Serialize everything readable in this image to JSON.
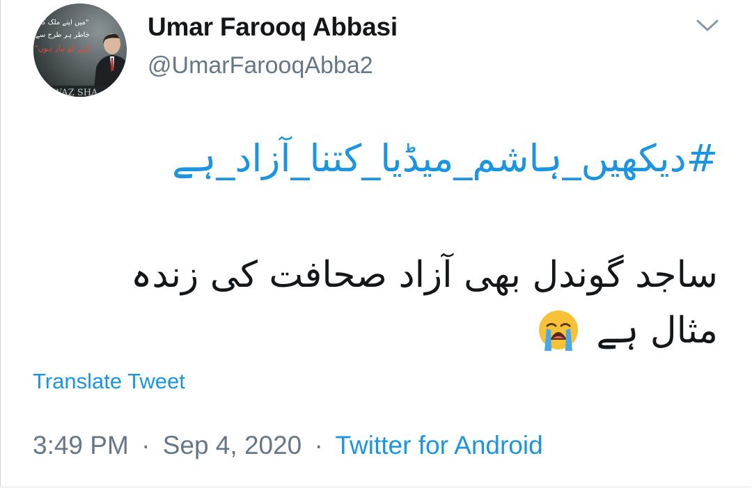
{
  "author": {
    "display_name": "Umar Farooq Abbasi",
    "handle": "@UmarFarooqAbba2",
    "avatar": {
      "icon": "profile-photo",
      "overlay_text_lines": [
        "\"میں اپنے ملک کی",
        "خاطر ہر طرح سے",
        "لڑنے کو تیار ہوں\""
      ],
      "footer_text": "WAZ SHA"
    }
  },
  "menu": {
    "icon": "chevron-down-icon"
  },
  "tweet": {
    "hashtag": "#دیکھیں_ہاشم_میڈیا_کتنا_آزاد_ہے",
    "text": "ساجد گوندل بھی آزاد صحافت کی زندہ مثال ہے",
    "emoji": "loudly-crying-face"
  },
  "translate_label": "Translate Tweet",
  "meta": {
    "time": "3:49 PM",
    "separator": "·",
    "date": "Sep 4, 2020",
    "source": "Twitter for Android"
  },
  "colors": {
    "link": "#1b95e0",
    "secondary_text": "#657786",
    "primary_text": "#14171a"
  }
}
